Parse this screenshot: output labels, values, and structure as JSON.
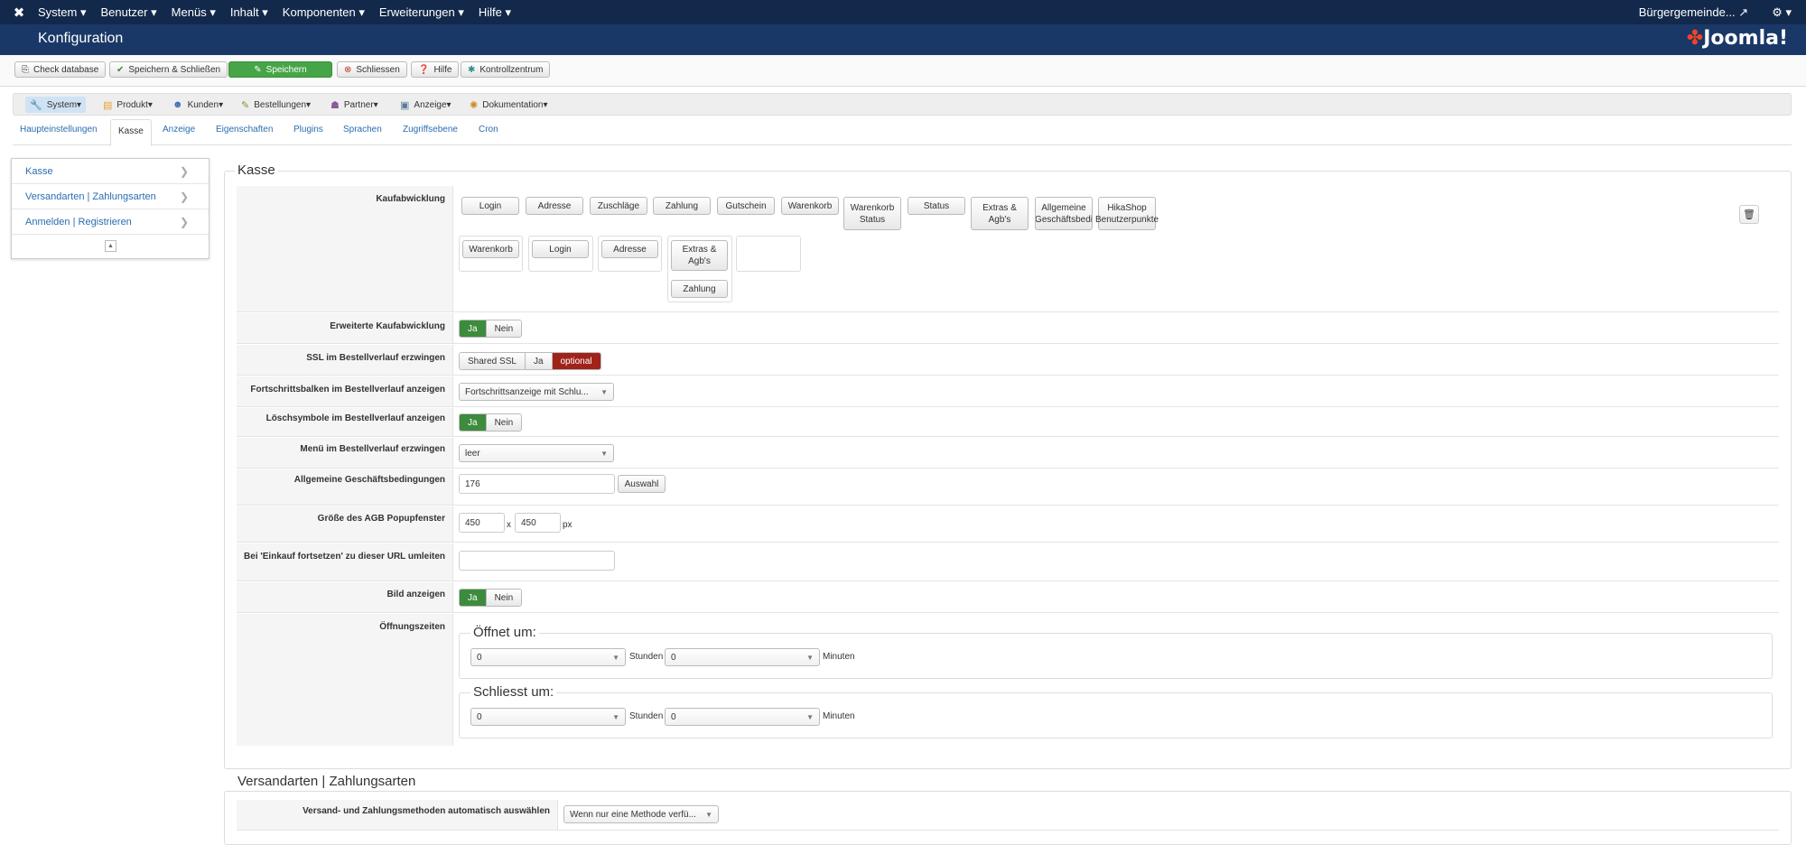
{
  "topnav": {
    "menu": [
      "System",
      "Benutzer",
      "Menüs",
      "Inhalt",
      "Komponenten",
      "Erweiterungen",
      "Hilfe"
    ],
    "site_link": "Bürgergemeinde..."
  },
  "header": {
    "title": "Konfiguration",
    "logo": "Joomla!"
  },
  "toolbar": {
    "check_database": "Check database",
    "save_close": "Speichern & Schließen",
    "save": "Speichern",
    "close": "Schliessen",
    "help": "Hilfe",
    "control_center": "Kontrollzentrum"
  },
  "hikanav": [
    "System",
    "Produkt",
    "Kunden",
    "Bestellungen",
    "Partner",
    "Anzeige",
    "Dokumentation"
  ],
  "tabs": [
    "Haupteinstellungen",
    "Kasse",
    "Anzeige",
    "Eigenschaften",
    "Plugins",
    "Sprachen",
    "Zugriffsebene",
    "Cron"
  ],
  "sidebar": [
    "Kasse",
    "Versandarten | Zahlungsarten",
    "Anmelden | Registrieren"
  ],
  "kasse": {
    "legend": "Kasse",
    "workflow_label": "Kaufabwicklung",
    "available_steps": [
      "Login",
      "Adresse",
      "Zuschläge",
      "Zahlung",
      "Gutschein",
      "Warenkorb",
      "Warenkorb Status",
      "Status",
      "Extras & Agb's",
      "Allgemeine Geschäftsbedi",
      "HikaShop Benutzerpunkte"
    ],
    "step_boxes": {
      "box1": [
        "Warenkorb"
      ],
      "box2": [
        "Login"
      ],
      "box3": [
        "Adresse"
      ],
      "box4": [
        "Extras & Agb's",
        "Zahlung"
      ]
    },
    "extended_label": "Erweiterte Kaufabwicklung",
    "ja": "Ja",
    "nein": "Nein",
    "ssl_label": "SSL im Bestellverlauf erzwingen",
    "ssl_options": [
      "Shared SSL",
      "Ja",
      "optional"
    ],
    "progress_label": "Fortschrittsbalken im Bestellverlauf anzeigen",
    "progress_value": "Fortschrittsanzeige mit Schlu...",
    "delete_label": "Löschsymbole im Bestellverlauf anzeigen",
    "menu_label": "Menü im Bestellverlauf erzwingen",
    "menu_value": "leer",
    "agb_label": "Allgemeine Geschäftsbedingungen",
    "agb_value": "176",
    "agb_button": "Auswahl",
    "popup_label": "Größe des AGB Popupfenster",
    "popup_width": "450",
    "popup_x": "x",
    "popup_height": "450",
    "popup_unit": "px",
    "continue_label": "Bei 'Einkauf fortsetzen' zu dieser URL umleiten",
    "continue_value": "",
    "image_label": "Bild anzeigen",
    "hours_label": "Öffnungszeiten",
    "opens_legend": "Öffnet um:",
    "closes_legend": "Schliesst um:",
    "hour_value": "0",
    "minute_value": "0",
    "hours_unit": "Stunden",
    "minutes_unit": "Minuten"
  },
  "versand": {
    "legend": "Versandarten | Zahlungsarten",
    "auto_label": "Versand- und Zahlungsmethoden automatisch auswählen",
    "auto_value": "Wenn nur eine Methode verfü..."
  }
}
